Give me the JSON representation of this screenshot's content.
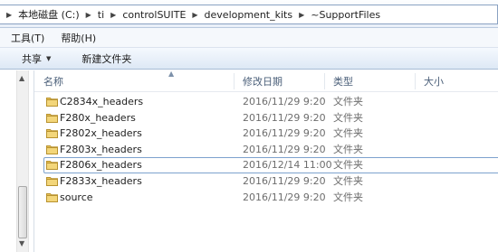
{
  "address": {
    "crumbs": [
      "本地磁盘 (C:)",
      "ti",
      "controlSUITE",
      "development_kits",
      "~SupportFiles"
    ]
  },
  "menu": {
    "tools": "工具(T)",
    "help": "帮助(H)"
  },
  "toolbar": {
    "share": "共享",
    "new_folder": "新建文件夹"
  },
  "columns": {
    "name": "名称",
    "date": "修改日期",
    "type": "类型",
    "size": "大小"
  },
  "files": [
    {
      "name": "C2834x_headers",
      "date": "2016/11/29 9:20",
      "type": "文件夹"
    },
    {
      "name": "F280x_headers",
      "date": "2016/11/29 9:20",
      "type": "文件夹"
    },
    {
      "name": "F2802x_headers",
      "date": "2016/11/29 9:20",
      "type": "文件夹"
    },
    {
      "name": "F2803x_headers",
      "date": "2016/11/29 9:20",
      "type": "文件夹"
    },
    {
      "name": "F2806x_headers",
      "date": "2016/12/14 11:00",
      "type": "文件夹",
      "selected": true
    },
    {
      "name": "F2833x_headers",
      "date": "2016/11/29 9:20",
      "type": "文件夹"
    },
    {
      "name": "source",
      "date": "2016/11/29 9:20",
      "type": "文件夹"
    }
  ],
  "icons": {
    "folder": "folder-icon",
    "breadcrumb_separator": "chevron-right-icon",
    "dropdown": "chevron-down-icon",
    "sort": "sort-up-icon"
  },
  "colors": {
    "selection_border": "#7da2ce",
    "folder": "#e8c25a"
  }
}
